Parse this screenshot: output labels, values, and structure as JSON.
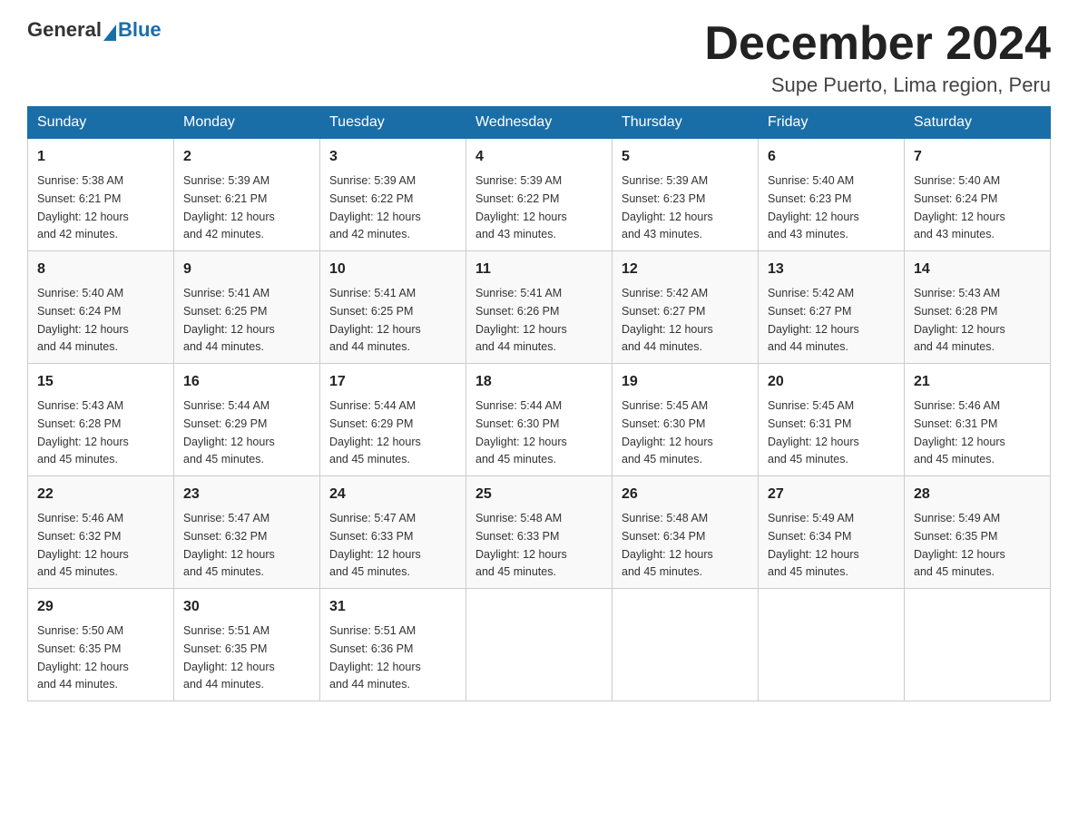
{
  "logo": {
    "general": "General",
    "blue": "Blue"
  },
  "header": {
    "month_year": "December 2024",
    "location": "Supe Puerto, Lima region, Peru"
  },
  "days_of_week": [
    "Sunday",
    "Monday",
    "Tuesday",
    "Wednesday",
    "Thursday",
    "Friday",
    "Saturday"
  ],
  "weeks": [
    [
      {
        "day": "1",
        "sunrise": "5:38 AM",
        "sunset": "6:21 PM",
        "daylight": "12 hours and 42 minutes."
      },
      {
        "day": "2",
        "sunrise": "5:39 AM",
        "sunset": "6:21 PM",
        "daylight": "12 hours and 42 minutes."
      },
      {
        "day": "3",
        "sunrise": "5:39 AM",
        "sunset": "6:22 PM",
        "daylight": "12 hours and 42 minutes."
      },
      {
        "day": "4",
        "sunrise": "5:39 AM",
        "sunset": "6:22 PM",
        "daylight": "12 hours and 43 minutes."
      },
      {
        "day": "5",
        "sunrise": "5:39 AM",
        "sunset": "6:23 PM",
        "daylight": "12 hours and 43 minutes."
      },
      {
        "day": "6",
        "sunrise": "5:40 AM",
        "sunset": "6:23 PM",
        "daylight": "12 hours and 43 minutes."
      },
      {
        "day": "7",
        "sunrise": "5:40 AM",
        "sunset": "6:24 PM",
        "daylight": "12 hours and 43 minutes."
      }
    ],
    [
      {
        "day": "8",
        "sunrise": "5:40 AM",
        "sunset": "6:24 PM",
        "daylight": "12 hours and 44 minutes."
      },
      {
        "day": "9",
        "sunrise": "5:41 AM",
        "sunset": "6:25 PM",
        "daylight": "12 hours and 44 minutes."
      },
      {
        "day": "10",
        "sunrise": "5:41 AM",
        "sunset": "6:25 PM",
        "daylight": "12 hours and 44 minutes."
      },
      {
        "day": "11",
        "sunrise": "5:41 AM",
        "sunset": "6:26 PM",
        "daylight": "12 hours and 44 minutes."
      },
      {
        "day": "12",
        "sunrise": "5:42 AM",
        "sunset": "6:27 PM",
        "daylight": "12 hours and 44 minutes."
      },
      {
        "day": "13",
        "sunrise": "5:42 AM",
        "sunset": "6:27 PM",
        "daylight": "12 hours and 44 minutes."
      },
      {
        "day": "14",
        "sunrise": "5:43 AM",
        "sunset": "6:28 PM",
        "daylight": "12 hours and 44 minutes."
      }
    ],
    [
      {
        "day": "15",
        "sunrise": "5:43 AM",
        "sunset": "6:28 PM",
        "daylight": "12 hours and 45 minutes."
      },
      {
        "day": "16",
        "sunrise": "5:44 AM",
        "sunset": "6:29 PM",
        "daylight": "12 hours and 45 minutes."
      },
      {
        "day": "17",
        "sunrise": "5:44 AM",
        "sunset": "6:29 PM",
        "daylight": "12 hours and 45 minutes."
      },
      {
        "day": "18",
        "sunrise": "5:44 AM",
        "sunset": "6:30 PM",
        "daylight": "12 hours and 45 minutes."
      },
      {
        "day": "19",
        "sunrise": "5:45 AM",
        "sunset": "6:30 PM",
        "daylight": "12 hours and 45 minutes."
      },
      {
        "day": "20",
        "sunrise": "5:45 AM",
        "sunset": "6:31 PM",
        "daylight": "12 hours and 45 minutes."
      },
      {
        "day": "21",
        "sunrise": "5:46 AM",
        "sunset": "6:31 PM",
        "daylight": "12 hours and 45 minutes."
      }
    ],
    [
      {
        "day": "22",
        "sunrise": "5:46 AM",
        "sunset": "6:32 PM",
        "daylight": "12 hours and 45 minutes."
      },
      {
        "day": "23",
        "sunrise": "5:47 AM",
        "sunset": "6:32 PM",
        "daylight": "12 hours and 45 minutes."
      },
      {
        "day": "24",
        "sunrise": "5:47 AM",
        "sunset": "6:33 PM",
        "daylight": "12 hours and 45 minutes."
      },
      {
        "day": "25",
        "sunrise": "5:48 AM",
        "sunset": "6:33 PM",
        "daylight": "12 hours and 45 minutes."
      },
      {
        "day": "26",
        "sunrise": "5:48 AM",
        "sunset": "6:34 PM",
        "daylight": "12 hours and 45 minutes."
      },
      {
        "day": "27",
        "sunrise": "5:49 AM",
        "sunset": "6:34 PM",
        "daylight": "12 hours and 45 minutes."
      },
      {
        "day": "28",
        "sunrise": "5:49 AM",
        "sunset": "6:35 PM",
        "daylight": "12 hours and 45 minutes."
      }
    ],
    [
      {
        "day": "29",
        "sunrise": "5:50 AM",
        "sunset": "6:35 PM",
        "daylight": "12 hours and 44 minutes."
      },
      {
        "day": "30",
        "sunrise": "5:51 AM",
        "sunset": "6:35 PM",
        "daylight": "12 hours and 44 minutes."
      },
      {
        "day": "31",
        "sunrise": "5:51 AM",
        "sunset": "6:36 PM",
        "daylight": "12 hours and 44 minutes."
      },
      null,
      null,
      null,
      null
    ]
  ],
  "labels": {
    "sunrise": "Sunrise:",
    "sunset": "Sunset:",
    "daylight": "Daylight:"
  }
}
